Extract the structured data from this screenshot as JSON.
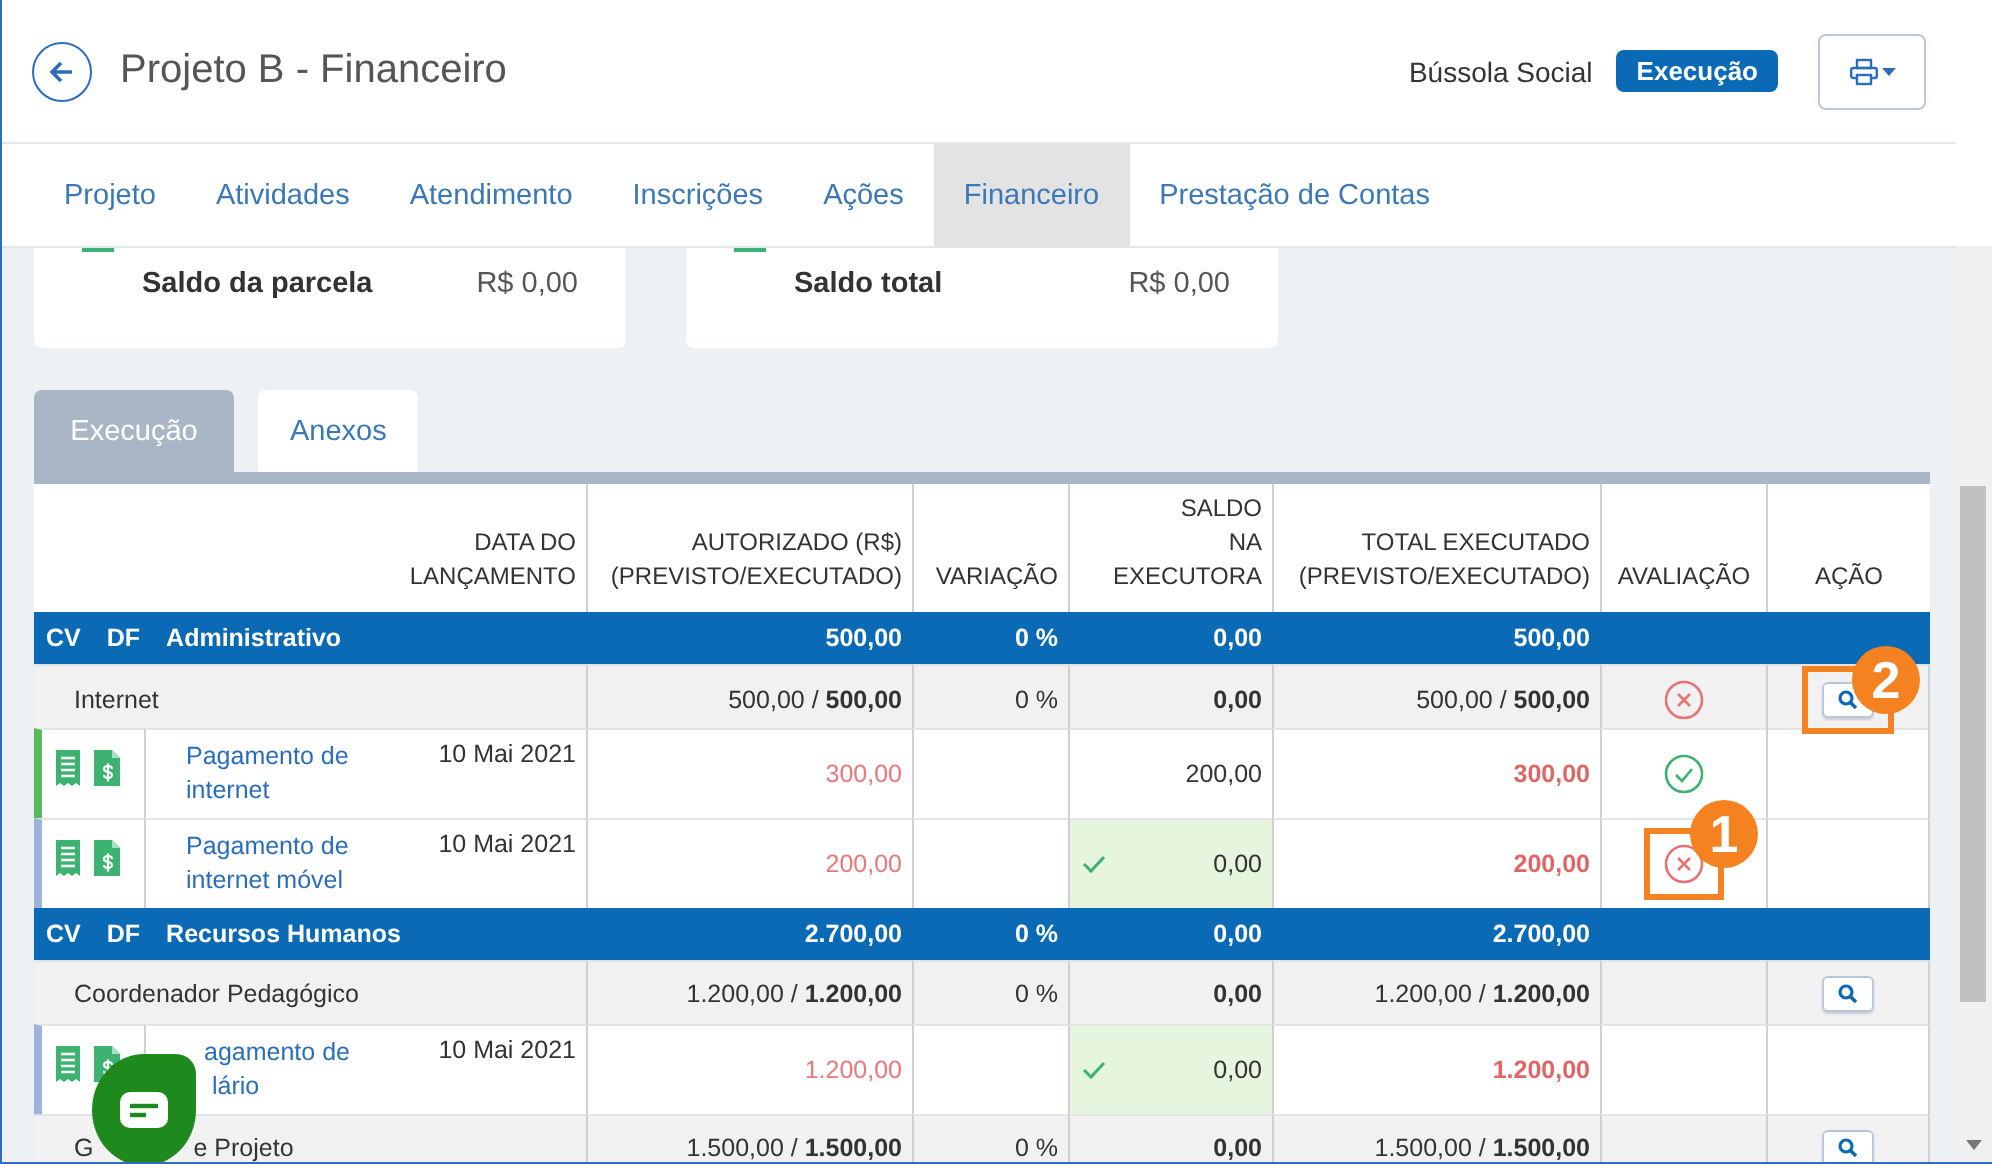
{
  "header": {
    "title": "Projeto B - Financeiro",
    "organization": "Bússola Social",
    "status_badge": "Execução"
  },
  "tabs": [
    {
      "label": "Projeto",
      "selected": false
    },
    {
      "label": "Atividades",
      "selected": false
    },
    {
      "label": "Atendimento",
      "selected": false
    },
    {
      "label": "Inscrições",
      "selected": false
    },
    {
      "label": "Ações",
      "selected": false
    },
    {
      "label": "Financeiro",
      "selected": true
    },
    {
      "label": "Prestação de Contas",
      "selected": false
    }
  ],
  "summary_cards": [
    {
      "label": "Saldo da parcela",
      "value": "R$ 0,00"
    },
    {
      "label": "Saldo total",
      "value": "R$ 0,00"
    }
  ],
  "section_tabs": [
    {
      "label": "Execução",
      "selected": true
    },
    {
      "label": "Anexos",
      "selected": false
    }
  ],
  "table": {
    "columns": [
      "DATA DO\nLANÇAMENTO",
      "AUTORIZADO (R$)\n(PREVISTO/EXECUTADO)",
      "VARIAÇÃO",
      "SALDO\nNA\nEXECUTORA",
      "TOTAL EXECUTADO\n(PREVISTO/EXECUTADO)",
      "AVALIAÇÃO",
      "AÇÃO"
    ],
    "rows": [
      {
        "kind": "group",
        "cv": "CV",
        "df": "DF",
        "name": "Administrativo",
        "authorized": "500,00",
        "variation": "0 %",
        "balance": "0,00",
        "total": "500,00"
      },
      {
        "kind": "item",
        "name_parts": [
          "Internet"
        ],
        "authorized": "500,00 / **500,00**",
        "variation": "0 %",
        "balance": "0,00",
        "total": "500,00 / **500,00**",
        "approved": false,
        "has_action": true,
        "annotation": "2"
      },
      {
        "kind": "entry",
        "color": "#5cb85c",
        "description_lines": [
          "Pagamento de",
          "internet"
        ],
        "date": "10 Mai 2021",
        "authorized": "300,00",
        "balance": "200,00",
        "balance_confirmed": false,
        "total": "300,00",
        "approved": true
      },
      {
        "kind": "entry",
        "color": "#9db3dc",
        "description_lines": [
          "Pagamento de",
          "internet móvel"
        ],
        "date": "10 Mai 2021",
        "authorized": "200,00",
        "balance": "0,00",
        "balance_confirmed": true,
        "total": "200,00",
        "approved": false,
        "annotation": "1"
      },
      {
        "kind": "group",
        "cv": "CV",
        "df": "DF",
        "name": "Recursos Humanos",
        "authorized": "2.700,00",
        "variation": "0 %",
        "balance": "0,00",
        "total": "2.700,00"
      },
      {
        "kind": "item",
        "name_parts": [
          "Coordenador Pedagógico"
        ],
        "authorized": "1.200,00 / **1.200,00**",
        "variation": "0 %",
        "balance": "0,00",
        "total": "1.200,00 / **1.200,00**",
        "has_action": true
      },
      {
        "kind": "entry",
        "color": "#9db3dc",
        "description_lines": [
          "agamento de",
          "lário"
        ],
        "date": "10 Mai 2021",
        "authorized": "1.200,00",
        "balance": "0,00",
        "balance_confirmed": true,
        "total": "1.200,00"
      },
      {
        "kind": "item",
        "name_parts": [
          "G",
          "e Projeto"
        ],
        "authorized": "1.500,00 / **1.500,00**",
        "variation": "0 %",
        "balance": "0,00",
        "total": "1.500,00 / **1.500,00**",
        "has_action": true
      }
    ]
  }
}
